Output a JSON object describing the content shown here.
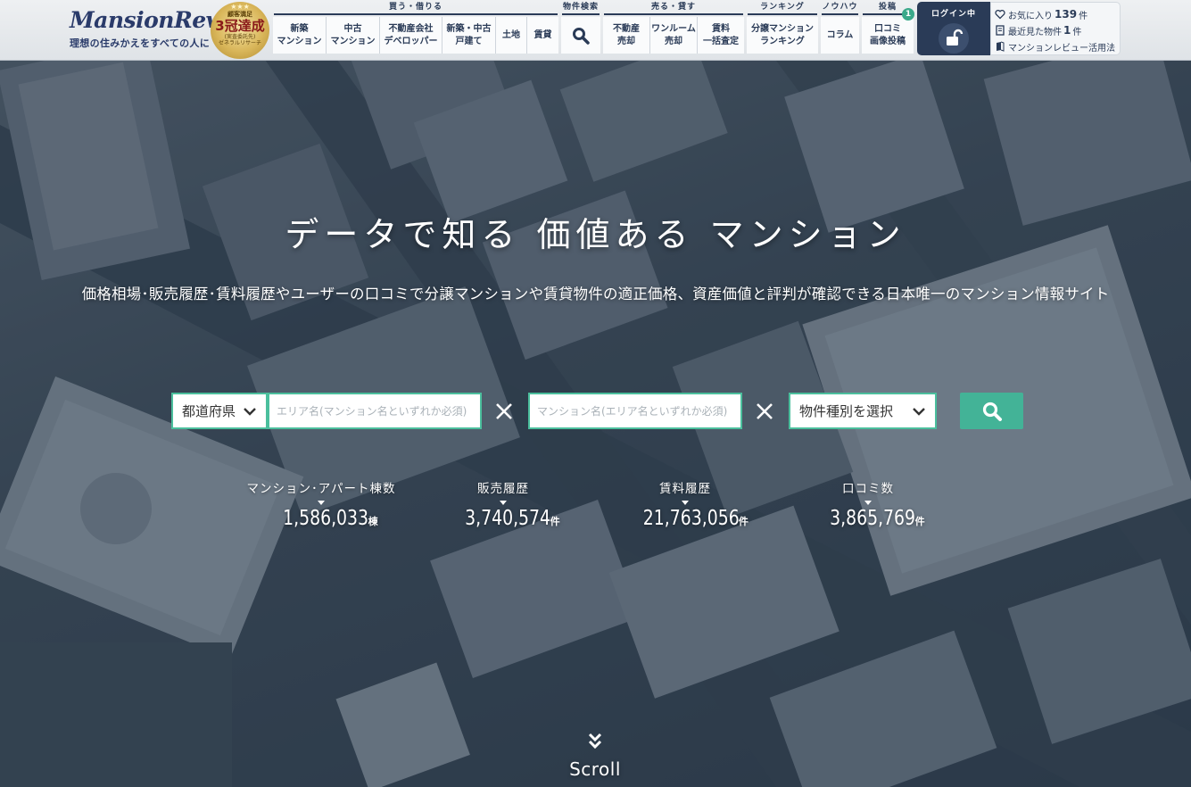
{
  "header": {
    "logo_text": "MansionReview",
    "logo_tagline": "理想の住みかえをすべての人に",
    "award": {
      "stars": "★★★",
      "sub": "顧客満足",
      "main": "3冠達成",
      "foot1": "(実査委託先)",
      "foot2": "ゼネラルリサーチ"
    },
    "nav_groups": [
      {
        "title": "買う・借りる",
        "items": [
          "新築\nマンション",
          "中古\nマンション",
          "不動産会社\nデベロッパー",
          "新築・中古\n戸建て",
          "土地",
          "賃貸"
        ]
      },
      {
        "title": "物件検索",
        "items": []
      },
      {
        "title": "売る・貸す",
        "items": [
          "不動産\n売却",
          "ワンルーム\n売却",
          "賃料\n一括査定"
        ]
      },
      {
        "title": "ランキング",
        "items": [
          "分譲マンション\nランキング"
        ]
      },
      {
        "title": "ノウハウ",
        "items": [
          "コラム"
        ]
      },
      {
        "title": "投稿",
        "items": [
          "口コミ\n画像投稿"
        ]
      }
    ],
    "post_badge": "1",
    "login_label": "ログイン中",
    "favorites": {
      "prefix": "お気に入り",
      "count": "139",
      "suffix": "件"
    },
    "recent": {
      "prefix": "最近見た物件",
      "count": "1",
      "suffix": "件"
    },
    "guide_link": "マンションレビュー活用法"
  },
  "hero": {
    "title": "データで知る 価値ある マンション",
    "subtitle": "価格相場･販売履歴･賃料履歴やユーザーの口コミで分譲マンションや賃貸物件の適正価格、資産価値と評判が確認できる日本唯一のマンション情報サイト"
  },
  "search": {
    "prefecture_label": "都道府県",
    "area_placeholder": "エリア名(マンション名といずれか必須)",
    "name_placeholder": "マンション名(エリア名といずれか必須)",
    "type_label": "物件種別を選択"
  },
  "stats": [
    {
      "label": "マンション･アパート棟数",
      "value": "1,586,033",
      "unit": "棟"
    },
    {
      "label": "販売履歴",
      "value": "3,740,574",
      "unit": "件"
    },
    {
      "label": "賃料履歴",
      "value": "21,763,056",
      "unit": "件"
    },
    {
      "label": "口コミ数",
      "value": "3,865,769",
      "unit": "件"
    }
  ],
  "scroll_label": "Scroll",
  "colors": {
    "navy": "#2a3b57",
    "accent": "#43b397",
    "border_green": "#4bbf9d",
    "badge": "#3aa98a"
  }
}
